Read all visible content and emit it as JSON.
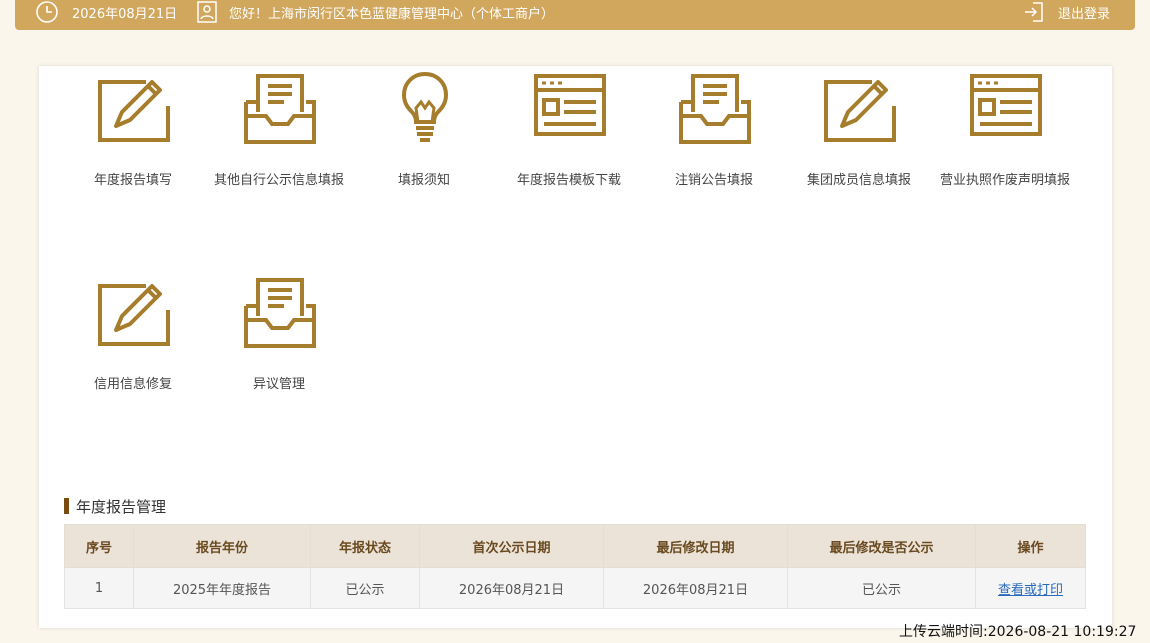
{
  "header": {
    "date": "2026年08月21日",
    "greeting": "您好！上海市闵行区本色蓝健康管理中心（个体工商户）",
    "logout": "退出登录"
  },
  "menu": [
    {
      "label": "年度报告填写",
      "icon": "edit-pencil-icon"
    },
    {
      "label": "其他自行公示信息填报",
      "icon": "inbox-document-icon"
    },
    {
      "label": "填报须知",
      "icon": "lightbulb-icon"
    },
    {
      "label": "年度报告模板下载",
      "icon": "template-window-icon"
    },
    {
      "label": "注销公告填报",
      "icon": "inbox-document-icon"
    },
    {
      "label": "集团成员信息填报",
      "icon": "edit-pencil-icon"
    },
    {
      "label": "营业执照作废声明填报",
      "icon": "template-window-icon"
    },
    {
      "label": "信用信息修复",
      "icon": "edit-pencil-icon"
    },
    {
      "label": "异议管理",
      "icon": "inbox-document-icon"
    }
  ],
  "section": {
    "title": "年度报告管理"
  },
  "table": {
    "headers": [
      "序号",
      "报告年份",
      "年报状态",
      "首次公示日期",
      "最后修改日期",
      "最后修改是否公示",
      "操作"
    ],
    "rows": [
      [
        "1",
        "2025年年度报告",
        "已公示",
        "2026年08月21日",
        "2026年08月21日",
        "已公示",
        "查看或打印"
      ]
    ]
  },
  "footer": {
    "upload_time": "上传云端时间:2026-08-21 10:19:27"
  },
  "colors": {
    "gold": "#d0a75d",
    "icon": "#a57d2c",
    "section_bar": "#7a4a10",
    "link": "#2a6bbf"
  }
}
